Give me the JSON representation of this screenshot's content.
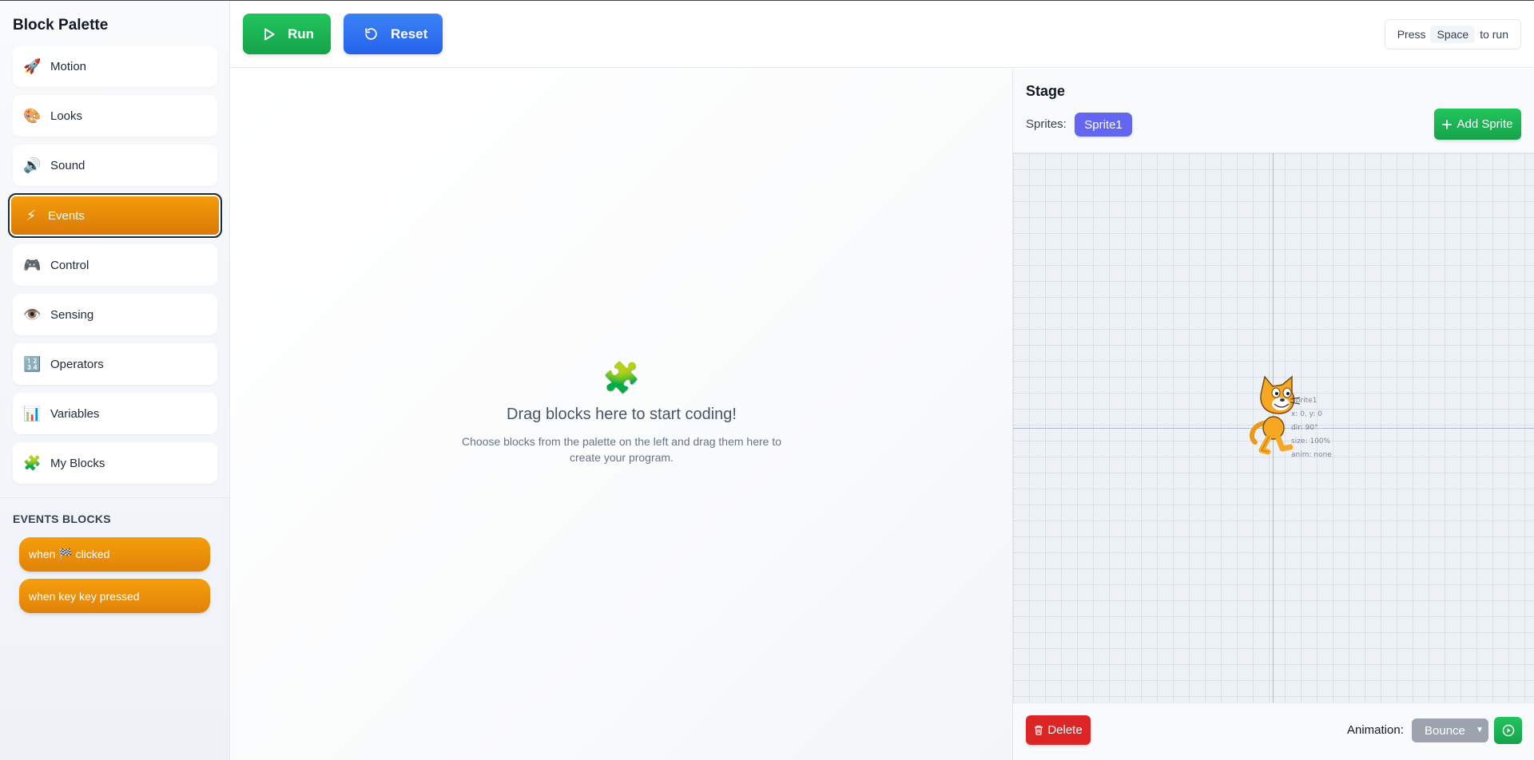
{
  "sidebar": {
    "title": "Block Palette",
    "categories": [
      {
        "label": "Motion",
        "icon": "🚀"
      },
      {
        "label": "Looks",
        "icon": "🎨"
      },
      {
        "label": "Sound",
        "icon": "🔊"
      },
      {
        "label": "Events",
        "icon": "⚡",
        "active": true
      },
      {
        "label": "Control",
        "icon": "🎮"
      },
      {
        "label": "Sensing",
        "icon": "👁️"
      },
      {
        "label": "Operators",
        "icon": "🔢"
      },
      {
        "label": "Variables",
        "icon": "📊"
      },
      {
        "label": "My Blocks",
        "icon": "🧩"
      }
    ],
    "section_title": "EVENTS BLOCKS",
    "blocks": [
      {
        "label": "when 🏁 clicked"
      },
      {
        "label": "when key key pressed"
      }
    ],
    "accent_color": "#f59e0b"
  },
  "toolbar": {
    "run_label": "Run",
    "reset_label": "Reset",
    "hint_prefix": "Press",
    "hint_key": "Space",
    "hint_suffix": "to run"
  },
  "workspace": {
    "icon": "🧩",
    "empty_title": "Drag blocks here to start coding!",
    "empty_desc": "Choose blocks from the palette on the left and drag them here to create your program."
  },
  "stage": {
    "title": "Stage",
    "sprites_label": "Sprites:",
    "sprites": [
      "Sprite1"
    ],
    "add_sprite_label": "Add Sprite",
    "sprite_info": {
      "name": "Sprite1",
      "xy": "x: 0, y: 0",
      "direction": "dir: 90°",
      "size": "size: 100%",
      "anim": "anim: none"
    },
    "delete_label": "Delete",
    "animation_label": "Animation:",
    "animation_value": "Bounce"
  },
  "colors": {
    "run": "#22c55e",
    "reset": "#3b82f6",
    "sprite_chip": "#6366f1",
    "delete": "#dc2626"
  }
}
